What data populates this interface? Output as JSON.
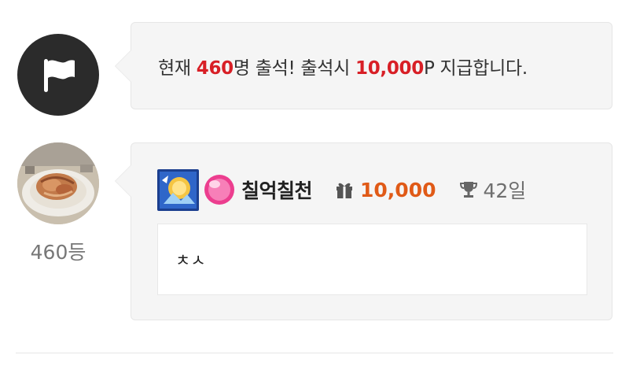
{
  "notice": {
    "prefix": "현재 ",
    "count": "460",
    "middle": "명 출석! 출석시 ",
    "points": "10,000",
    "suffix": "P 지급합니다."
  },
  "entry": {
    "rank": "460등",
    "nickname": "칠억칠천",
    "points": "10,000",
    "days": "42일",
    "comment": "ㅊㅅ"
  },
  "colors": {
    "highlight_red": "#d81f26",
    "points_orange": "#e05a17",
    "bubble_bg": "#f5f5f5",
    "flag_avatar_bg": "#2b2b2b"
  },
  "icons": {
    "notice_avatar": "flag-icon",
    "level": "level-icon",
    "gem": "gem-icon",
    "points": "gift-icon",
    "days": "trophy-icon"
  }
}
